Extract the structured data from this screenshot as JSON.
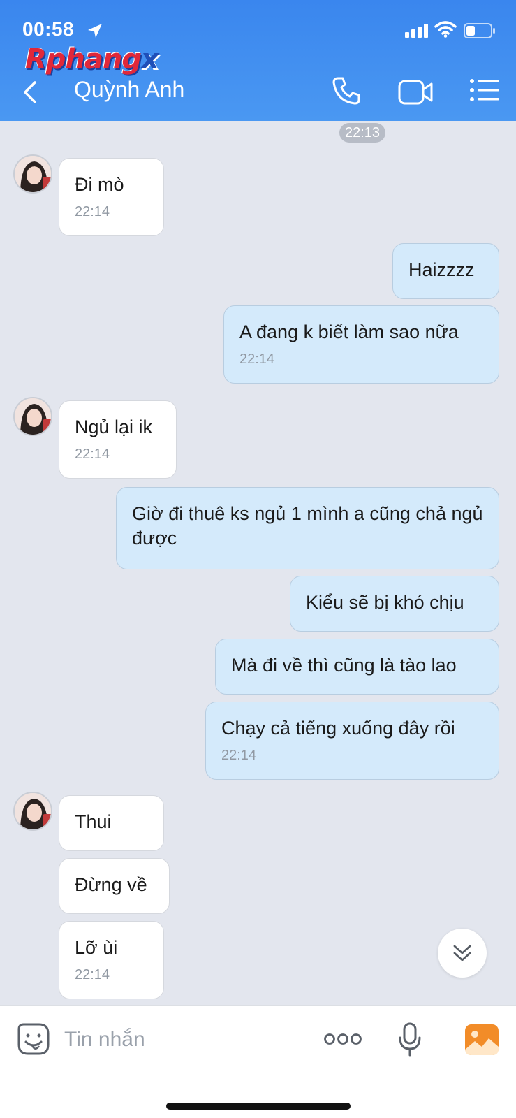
{
  "status_bar": {
    "time": "00:58"
  },
  "watermark": {
    "part1": "Rphang",
    "part2": "x"
  },
  "header": {
    "contact_name": "Quỳnh Anh"
  },
  "chat": {
    "time_divider": "22:13",
    "messages": [
      {
        "dir": "in",
        "text": "Đi mò",
        "time": "22:14"
      },
      {
        "dir": "out",
        "text": "Haizzzz"
      },
      {
        "dir": "out",
        "text": "A đang k biết làm sao nữa",
        "time": "22:14"
      },
      {
        "dir": "in",
        "text": "Ngủ lại ik",
        "time": "22:14"
      },
      {
        "dir": "out",
        "text": "Giờ đi thuê ks ngủ 1 mình a cũng chả ngủ được"
      },
      {
        "dir": "out",
        "text": "Kiểu sẽ bị khó chịu"
      },
      {
        "dir": "out",
        "text": "Mà đi về thì cũng là tào lao"
      },
      {
        "dir": "out",
        "text": "Chạy cả tiếng xuống đây rồi",
        "time": "22:14"
      },
      {
        "dir": "in",
        "text": "Thui"
      },
      {
        "dir": "in",
        "text": "Đừng về"
      },
      {
        "dir": "in",
        "text": "Lỡ ùi",
        "time": "22:14"
      }
    ]
  },
  "input": {
    "placeholder": "Tin nhắn"
  },
  "icons": {
    "back": "chevron-left-icon",
    "call": "phone-icon",
    "video": "video-camera-icon",
    "menu": "list-menu-icon",
    "emoji": "sticker-emoji-icon",
    "more": "more-dots-icon",
    "mic": "microphone-icon",
    "photo": "image-gallery-icon",
    "scroll": "double-chevron-down-icon"
  },
  "colors": {
    "header": "#3a86ee",
    "chat_bg": "#e3e6ee",
    "bubble_out": "#d4eafb",
    "bubble_in": "#ffffff",
    "photo_icon": "#f28c28"
  }
}
